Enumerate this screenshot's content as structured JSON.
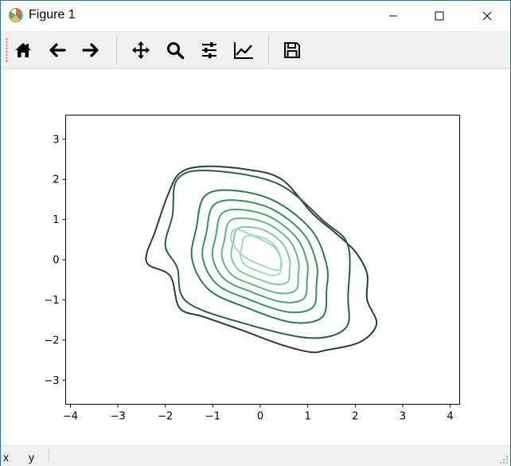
{
  "window": {
    "title": "Figure 1"
  },
  "toolbar": {
    "buttons": [
      {
        "name": "home",
        "icon": "home-icon"
      },
      {
        "name": "back",
        "icon": "arrow-left-icon"
      },
      {
        "name": "forward",
        "icon": "arrow-right-icon"
      },
      {
        "name": "pan",
        "icon": "move-icon"
      },
      {
        "name": "zoom",
        "icon": "magnifier-icon"
      },
      {
        "name": "subplots",
        "icon": "sliders-icon"
      },
      {
        "name": "customize",
        "icon": "line-chart-icon"
      },
      {
        "name": "save",
        "icon": "floppy-disk-icon"
      }
    ]
  },
  "status": {
    "x_label": "x",
    "y_label": "y"
  },
  "chart_data": {
    "type": "contour",
    "title": "",
    "xlabel": "",
    "ylabel": "",
    "xlim": [
      -4.1,
      4.2
    ],
    "ylim": [
      -3.6,
      3.6
    ],
    "xticks": [
      "−4",
      "−3",
      "−2",
      "−1",
      "0",
      "1",
      "2",
      "3",
      "4"
    ],
    "yticks": [
      "3",
      "2",
      "1",
      "0",
      "−1",
      "−2",
      "−3"
    ],
    "grid": false,
    "levels": [
      {
        "level": 1,
        "color": "#2c3e3a"
      },
      {
        "level": 2,
        "color": "#2b5e47"
      },
      {
        "level": 3,
        "color": "#2c7a4e"
      },
      {
        "level": 4,
        "color": "#35935c"
      },
      {
        "level": 5,
        "color": "#4aa56d"
      },
      {
        "level": 6,
        "color": "#66b885"
      },
      {
        "level": 7,
        "color": "#85c9a3"
      },
      {
        "level": 8,
        "color": "#a3d9c2"
      }
    ]
  }
}
